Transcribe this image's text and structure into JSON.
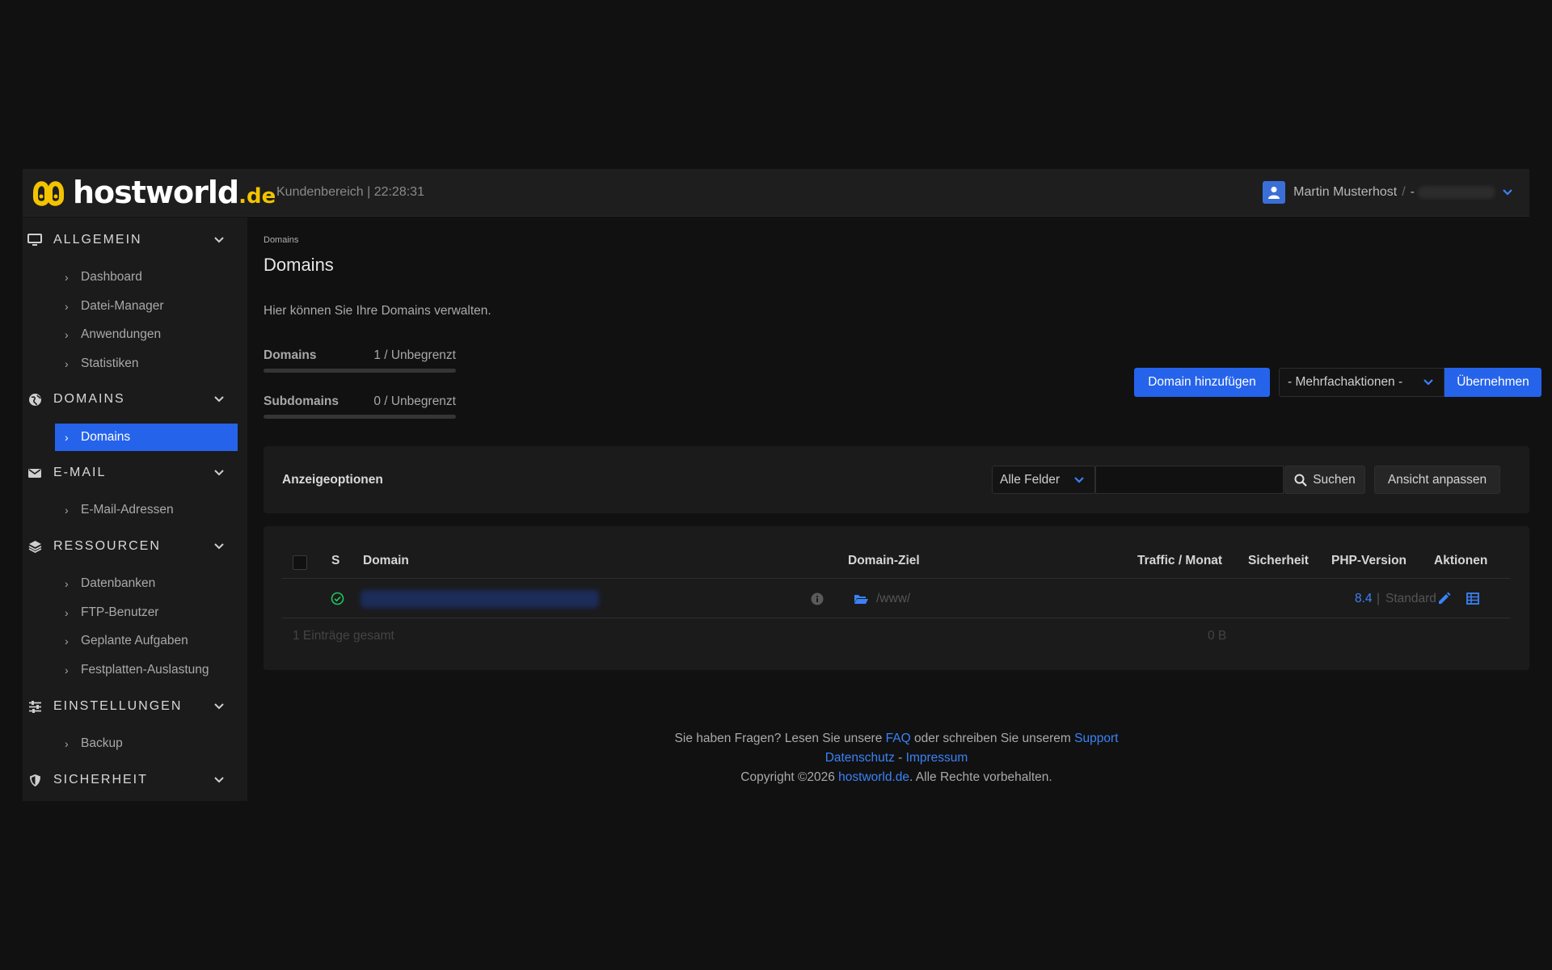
{
  "header": {
    "logo_text": "hostworld",
    "logo_tld": ".de",
    "info": "Kundenbereich | 22:28:31",
    "user_name": "Martin Musterhost",
    "user_sep": "/",
    "user_dash": "-"
  },
  "sidebar": {
    "sections": [
      {
        "label": "ALLGEMEIN",
        "icon": "monitor-icon",
        "items": [
          "Dashboard",
          "Datei-Manager",
          "Anwendungen",
          "Statistiken"
        ]
      },
      {
        "label": "DOMAINS",
        "icon": "globe-icon",
        "items": [
          "Domains"
        ]
      },
      {
        "label": "E-MAIL",
        "icon": "envelope-icon",
        "items": [
          "E-Mail-Adressen"
        ]
      },
      {
        "label": "RESSOURCEN",
        "icon": "layers-icon",
        "items": [
          "Datenbanken",
          "FTP-Benutzer",
          "Geplante Aufgaben",
          "Festplatten-Auslastung"
        ]
      },
      {
        "label": "EINSTELLUNGEN",
        "icon": "sliders-icon",
        "items": [
          "Backup"
        ]
      },
      {
        "label": "SICHERHEIT",
        "icon": "shield-icon",
        "items": []
      }
    ],
    "active_item": "Domains"
  },
  "page": {
    "breadcrumb": "Domains",
    "title": "Domains",
    "description": "Hier können Sie Ihre Domains verwalten."
  },
  "quotas": [
    {
      "label": "Domains",
      "value": "1 / Unbegrenzt"
    },
    {
      "label": "Subdomains",
      "value": "0 / Unbegrenzt"
    }
  ],
  "actions": {
    "add_domain": "Domain hinzufügen",
    "bulk_select": "- Mehrfachaktionen -",
    "apply": "Übernehmen"
  },
  "display_options": {
    "title": "Anzeigeoptionen",
    "field_select": "Alle Felder",
    "search_value": "",
    "search_button": "Suchen",
    "customize_button": "Ansicht anpassen"
  },
  "table": {
    "columns": [
      "S",
      "Domain",
      "Domain-Ziel",
      "Traffic / Monat",
      "Sicherheit",
      "PHP-Version",
      "Aktionen"
    ],
    "rows": [
      {
        "status": "ok",
        "target": "/www/",
        "php_version": "8.4",
        "php_sep": "|",
        "php_label": "Standard"
      }
    ],
    "summary_entries": "1 Einträge gesamt",
    "summary_traffic": "0 B"
  },
  "footer": {
    "line1_prefix": "Sie haben Fragen? Lesen Sie unsere",
    "faq": "FAQ",
    "line1_middle": "oder schreiben Sie unserem",
    "support": "Support",
    "privacy": "Datenschutz",
    "dash": "-",
    "imprint": "Impressum",
    "copyright_prefix": "Copyright ©2026",
    "site": "hostworld.de",
    "copyright_suffix": ". Alle Rechte vorbehalten."
  },
  "colors": {
    "accent": "#2563eb",
    "link": "#3b82f6",
    "brand_yellow": "#f3c300",
    "status_ok": "#22c55e"
  }
}
